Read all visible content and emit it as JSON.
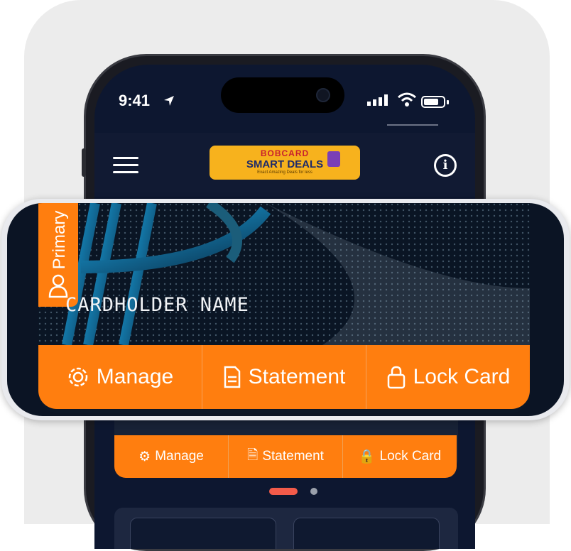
{
  "status_bar": {
    "time": "9:41"
  },
  "app_bar": {
    "logo": {
      "line1": "BOBCARD",
      "line2": "SMART DEALS",
      "tagline": "Exact Amazing Deals for less"
    }
  },
  "card": {
    "badge_label": "Primary",
    "cardholder": "CARDHOLDER NAME",
    "actions": [
      {
        "label": "Manage",
        "icon": "gear-icon"
      },
      {
        "label": "Statement",
        "icon": "document-icon"
      },
      {
        "label": "Lock Card",
        "icon": "lock-icon"
      }
    ]
  },
  "carousel": {
    "active_index": 0,
    "count": 2
  },
  "colors": {
    "accent": "#FF7E0F",
    "background": "#0D1730",
    "logo_bg": "#F7B21D"
  }
}
